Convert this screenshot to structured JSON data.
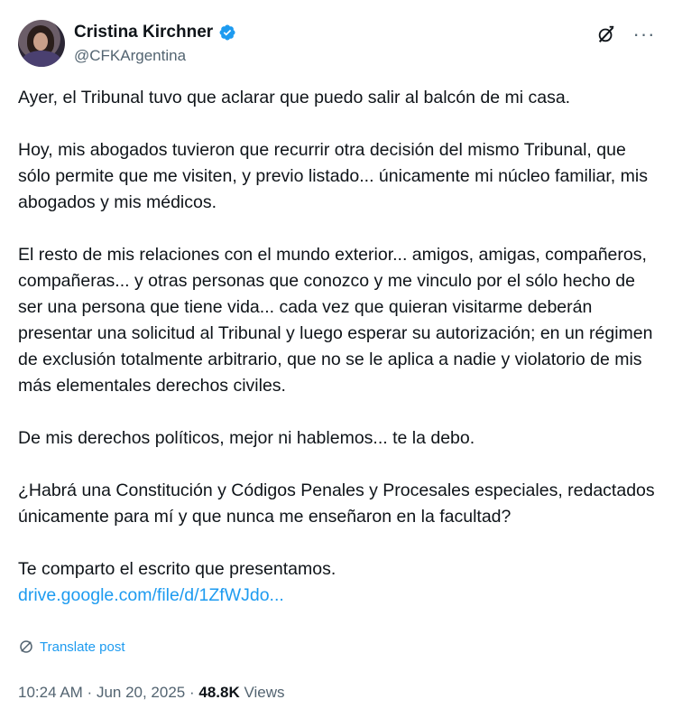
{
  "author": {
    "name": "Cristina Kirchner",
    "handle": "@CFKArgentina",
    "verified_icon": "verified-badge-icon",
    "verified_color": "#1d9bf0"
  },
  "actions": {
    "grok_icon": "grok-icon",
    "more_label": "···"
  },
  "post": {
    "paragraphs": [
      "Ayer, el Tribunal tuvo que aclarar que puedo salir al balcón de mi casa.",
      "Hoy, mis abogados tuvieron que recurrir otra decisión del mismo Tribunal, que sólo permite que me visiten, y previo listado... únicamente mi núcleo familiar, mis abogados y mis médicos.",
      "El resto de mis relaciones con el mundo exterior... amigos, amigas, compañeros, compañeras... y otras personas que conozco y me vinculo por el sólo hecho de ser una persona que tiene vida... cada vez que quieran visitarme deberán presentar una solicitud al Tribunal y luego esperar su autorización; en un régimen de exclusión totalmente arbitrario, que no se le aplica a nadie y violatorio de mis más elementales derechos civiles.",
      "De mis derechos políticos, mejor ni hablemos... te la debo.",
      "¿Habrá una Constitución y Códigos Penales y Procesales especiales, redactados únicamente para mí y que nunca me enseñaron en la facultad?"
    ],
    "closing": "Te comparto el escrito que presentamos.",
    "link": "drive.google.com/file/d/1ZfWJdo..."
  },
  "translate_label": "Translate post",
  "meta": {
    "time": "10:24 AM",
    "sep1": " · ",
    "date": "Jun 20, 2025",
    "sep2": " · ",
    "views_count": "48.8K",
    "views_label": " Views"
  }
}
